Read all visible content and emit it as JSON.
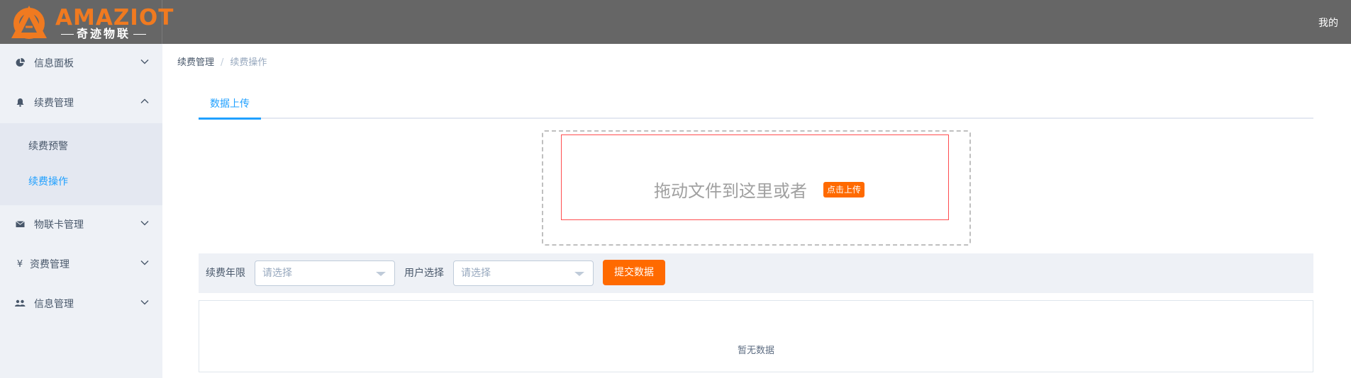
{
  "app": {
    "brand": "AMAZIOT",
    "brand_sub": "奇迹物联",
    "user_menu": "我的",
    "accent_color": "#ff6a00",
    "brand_color": "#f07a20",
    "active_color": "#20a0ff"
  },
  "sidebar": {
    "items": [
      {
        "label": "信息面板",
        "icon": "pie-chart-icon",
        "expanded": false
      },
      {
        "label": "续费管理",
        "icon": "bell-icon",
        "expanded": true
      },
      {
        "label": "物联卡管理",
        "icon": "envelope-icon",
        "expanded": false
      },
      {
        "label": "资费管理",
        "icon": "yen-icon",
        "expanded": false
      },
      {
        "label": "信息管理",
        "icon": "users-icon",
        "expanded": false
      }
    ],
    "submenu": [
      {
        "label": "续费预警",
        "active": false
      },
      {
        "label": "续费操作",
        "active": true
      }
    ]
  },
  "breadcrumb": {
    "first": "续费管理",
    "separator": "/",
    "last": "续费操作"
  },
  "tabs": [
    {
      "label": "数据上传",
      "active": true
    }
  ],
  "upload": {
    "drop_text": "拖动文件到这里或者",
    "button_label": "点击上传"
  },
  "filters": {
    "year_label": "续费年限",
    "year_placeholder": "请选择",
    "user_label": "用户选择",
    "user_placeholder": "请选择",
    "submit_label": "提交数据"
  },
  "table": {
    "empty_text": "暂无数据"
  }
}
